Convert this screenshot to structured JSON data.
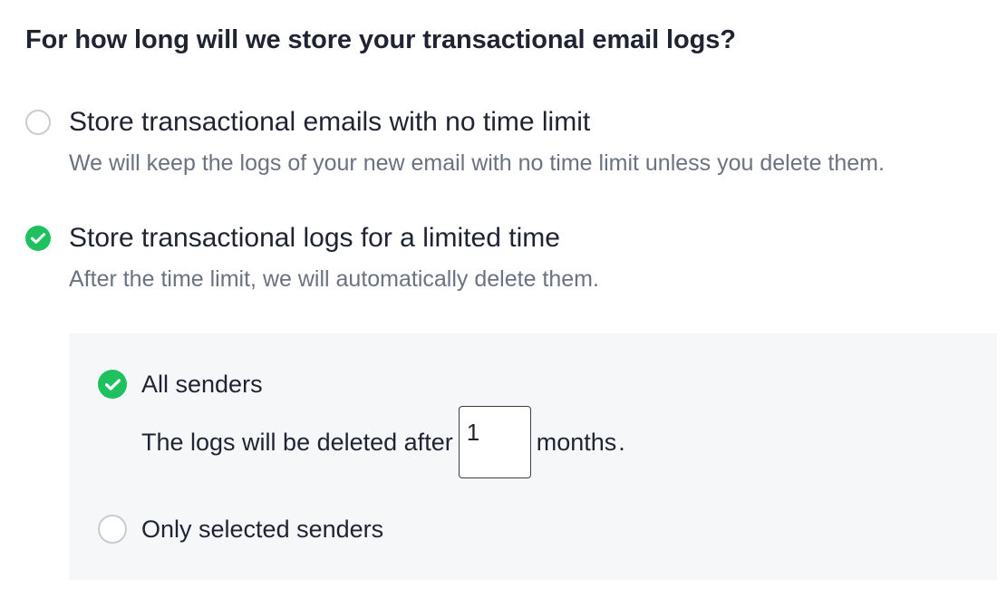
{
  "question": "For how long will we store your transactional email logs?",
  "options": [
    {
      "label": "Store transactional emails with no time limit",
      "description": "We will keep the logs of your new email with no time limit unless you delete them.",
      "selected": false
    },
    {
      "label": "Store transactional logs for a limited time",
      "description": "After the time limit, we will automatically delete them.",
      "selected": true
    }
  ],
  "limited": {
    "all_senders": {
      "label": "All senders",
      "selected": true
    },
    "retention": {
      "prefix": "The logs will be deleted after",
      "value": "1",
      "unit": "months",
      "suffix": "."
    },
    "selected_senders": {
      "label": "Only selected senders",
      "selected": false
    }
  },
  "colors": {
    "accent_green": "#1fc15f",
    "muted_text": "#6b7280",
    "panel_bg": "#f6f7f9"
  },
  "icons": {
    "checked": "check-circle-icon",
    "unchecked": "radio-empty-icon"
  }
}
